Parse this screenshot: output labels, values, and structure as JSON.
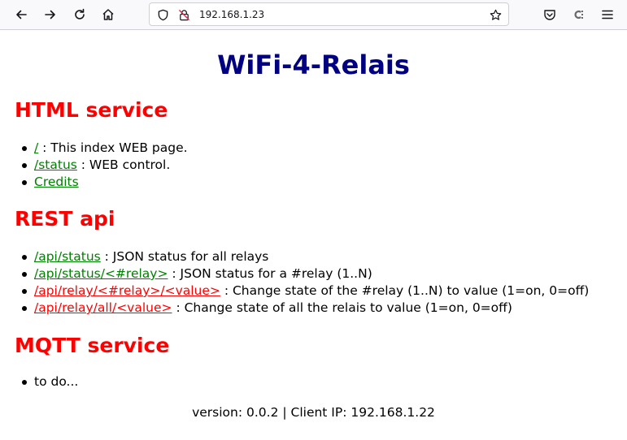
{
  "browser": {
    "url": "192.168.1.23",
    "icons": [
      "back-arrow-icon",
      "forward-arrow-icon",
      "reload-icon",
      "home-icon",
      "shield-icon",
      "insecure-lock-icon",
      "bookmark-star-icon",
      "pocket-icon",
      "extension-icon",
      "menu-icon"
    ]
  },
  "page": {
    "title": "WiFi-4-Relais",
    "title_color": "#000080",
    "heading_color": "#ff0000",
    "link_color": "#008000",
    "html_service": {
      "heading": "HTML service",
      "items": [
        {
          "link": "/",
          "desc": " : This index WEB page."
        },
        {
          "link": "/status",
          "desc": " : WEB control."
        },
        {
          "link": "Credits",
          "desc": ""
        }
      ]
    },
    "rest_api": {
      "heading": "REST api",
      "items": [
        {
          "link": "/api/status",
          "desc": " : JSON status for all relays"
        },
        {
          "link": "/api/status/<#relay>",
          "desc": " : JSON status for a #relay (1..N)"
        },
        {
          "link": "/api/relay/<#relay>/<value>",
          "desc": " : Change state of the #relay (1..N) to value (1=on, 0=off)"
        },
        {
          "link": "/api/relay/all/<value>",
          "desc": " : Change state of all the relais to value (1=on, 0=off)"
        }
      ]
    },
    "mqtt_service": {
      "heading": "MQTT service",
      "items": [
        {
          "text": "to do..."
        }
      ]
    },
    "footer": "version: 0.0.2 | Client IP: 192.168.1.22"
  }
}
